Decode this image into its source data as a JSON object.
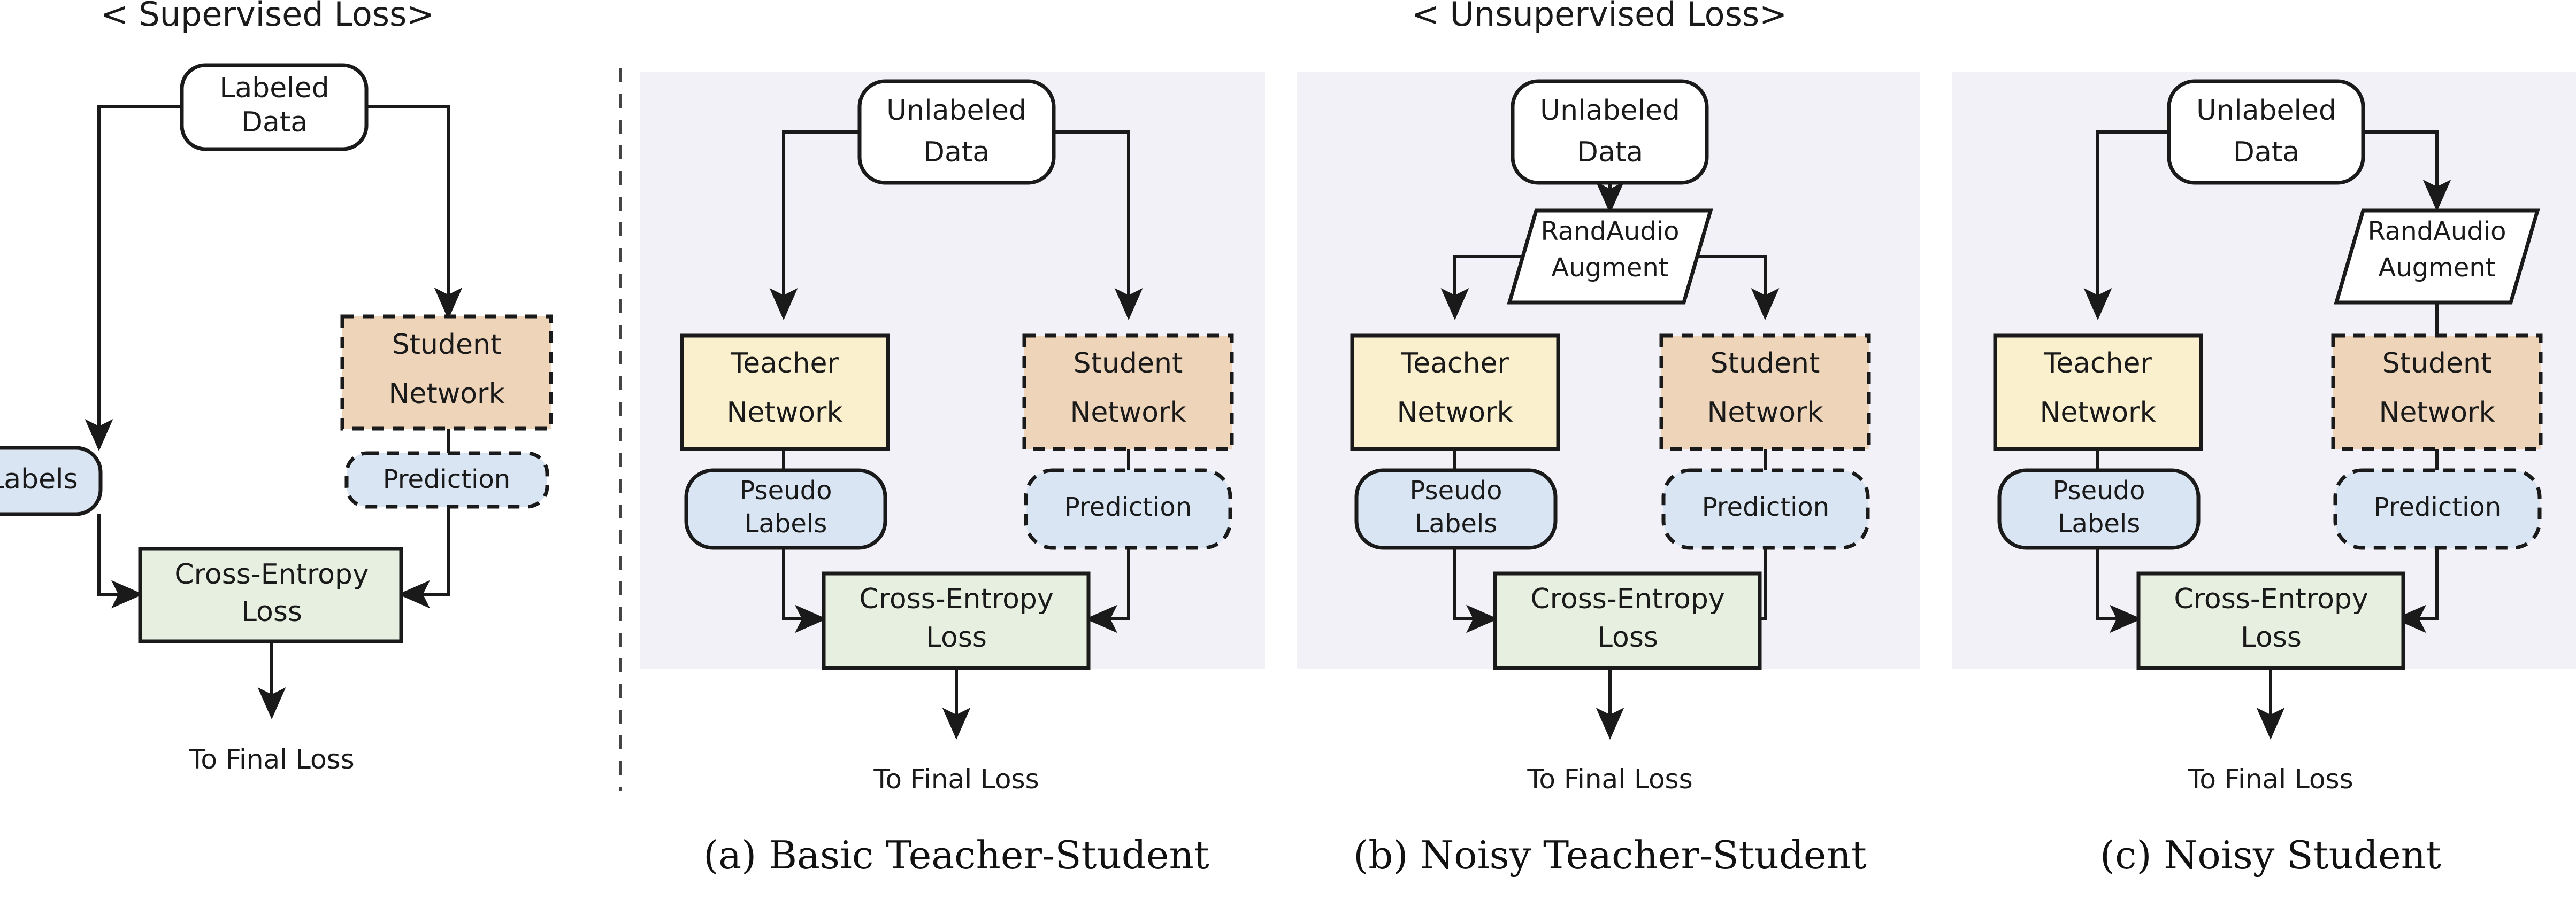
{
  "headers": {
    "supervised": "< Supervised Loss>",
    "unsupervised": "< Unsupervised Loss>"
  },
  "colors": {
    "panel_background": "#f1f1f7",
    "teacher_fill": "#faf0cd",
    "student_fill": "#eed4b9",
    "data_fill": "#ffffff",
    "labels_fill": "#d9e5f3",
    "loss_fill": "#e7efe0",
    "stroke": "#1a1a1a",
    "page_background": "#ffffff"
  },
  "captions": {
    "a": "(a) Basic Teacher-Student",
    "b": "(b) Noisy Teacher-Student",
    "c": "(c) Noisy Student"
  },
  "common": {
    "to_final_loss": "To Final Loss",
    "cross_entropy_line1": "Cross-Entropy",
    "cross_entropy_line2": "Loss",
    "teacher_line1": "Teacher",
    "teacher_line2": "Network",
    "student_line1": "Student",
    "student_line2": "Network",
    "pseudo_line1": "Pseudo",
    "pseudo_line2": "Labels",
    "prediction": "Prediction",
    "augment_line1": "RandAudio",
    "augment_line2": "Augment",
    "unlabeled_line1": "Unlabeled",
    "unlabeled_line2": "Data"
  },
  "panels": {
    "supervised": {
      "title": "< Supervised Loss>",
      "data_line1": "Labeled",
      "data_line2": "Data",
      "labels_node": "Labels",
      "student_line1": "Student",
      "student_line2": "Network",
      "prediction": "Prediction",
      "loss_line1": "Cross-Entropy",
      "loss_line2": "Loss",
      "output": "To Final Loss"
    },
    "a": {
      "caption": "(a) Basic Teacher-Student",
      "data_line1": "Unlabeled",
      "data_line2": "Data",
      "teacher_line1": "Teacher",
      "teacher_line2": "Network",
      "student_line1": "Student",
      "student_line2": "Network",
      "pseudo_line1": "Pseudo",
      "pseudo_line2": "Labels",
      "prediction": "Prediction",
      "loss_line1": "Cross-Entropy",
      "loss_line2": "Loss",
      "output": "To Final Loss",
      "has_augment": false
    },
    "b": {
      "caption": "(b) Noisy Teacher-Student",
      "data_line1": "Unlabeled",
      "data_line2": "Data",
      "augment_line1": "RandAudio",
      "augment_line2": "Augment",
      "teacher_line1": "Teacher",
      "teacher_line2": "Network",
      "student_line1": "Student",
      "student_line2": "Network",
      "pseudo_line1": "Pseudo",
      "pseudo_line2": "Labels",
      "prediction": "Prediction",
      "loss_line1": "Cross-Entropy",
      "loss_line2": "Loss",
      "output": "To Final Loss",
      "has_augment": true,
      "augment_position": "center"
    },
    "c": {
      "caption": "(c) Noisy Student",
      "data_line1": "Unlabeled",
      "data_line2": "Data",
      "augment_line1": "RandAudio",
      "augment_line2": "Augment",
      "teacher_line1": "Teacher",
      "teacher_line2": "Network",
      "student_line1": "Student",
      "student_line2": "Network",
      "pseudo_line1": "Pseudo",
      "pseudo_line2": "Labels",
      "prediction": "Prediction",
      "loss_line1": "Cross-Entropy",
      "loss_line2": "Loss",
      "output": "To Final Loss",
      "has_augment": true,
      "augment_position": "student-branch"
    }
  }
}
